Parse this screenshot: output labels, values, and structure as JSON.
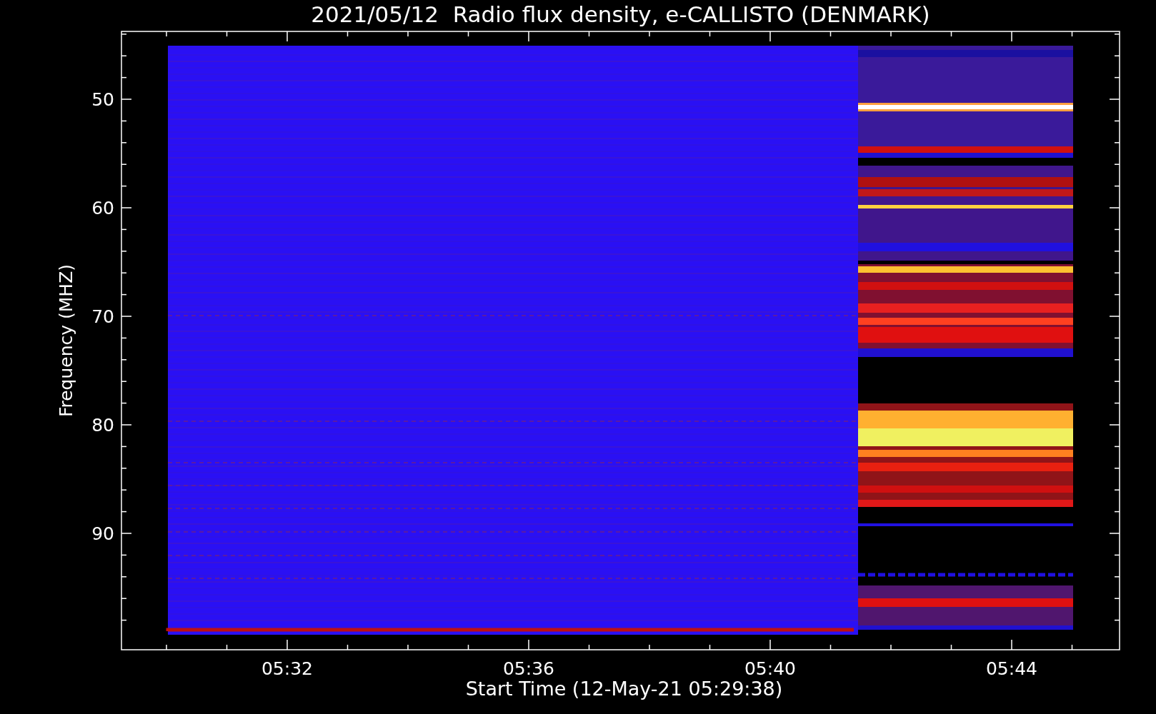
{
  "plot": {
    "title": "2021/05/12  Radio flux density, e-CALLISTO (DENMARK)",
    "ylabel": "Frequency (MHZ)",
    "xlabel": "Start Time (12-May-21 05:29:38)",
    "ytick_labels": [
      "50",
      "60",
      "70",
      "80",
      "90"
    ],
    "xtick_labels": [
      "05:32",
      "05:36",
      "05:40",
      "05:44"
    ]
  }
}
